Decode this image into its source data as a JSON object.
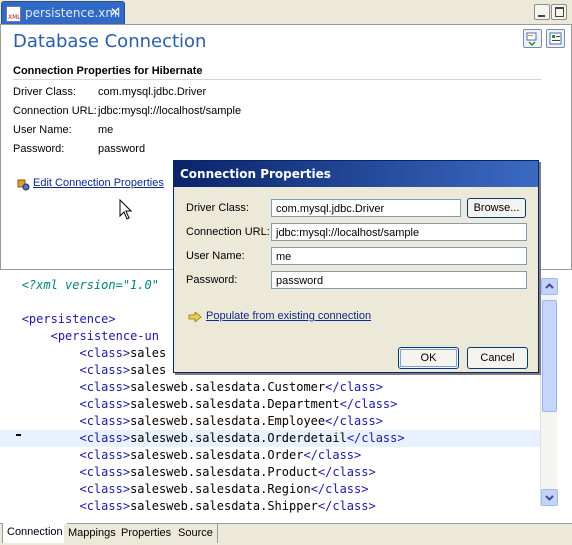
{
  "editor_tab": {
    "title": "persistence.xml",
    "icon": "xml-file-icon",
    "close_glyph": "✕"
  },
  "form": {
    "title": "Database Connection",
    "section_title": "Connection Properties for Hibernate",
    "properties": [
      {
        "label": "Driver Class:",
        "value": "com.mysql.jdbc.Driver"
      },
      {
        "label": "Connection URL:",
        "value": "jdbc:mysql://localhost/sample"
      },
      {
        "label": "User Name:",
        "value": "me"
      },
      {
        "label": "Password:",
        "value": "password"
      }
    ],
    "edit_link": "Edit Connection Properties"
  },
  "xml_lines": [
    {
      "pi": "<?xml version=\"1.0\""
    },
    {
      "text": ""
    },
    {
      "tag": "<persistence>"
    },
    {
      "indent": "    ",
      "tag": "<persistence-un"
    },
    {
      "indent": "        ",
      "tag": "<class>",
      "text": "sales"
    },
    {
      "indent": "        ",
      "tag": "<class>",
      "text": "sales"
    },
    {
      "indent": "        ",
      "tag": "<class>",
      "text": "salesweb.salesdata.Customer",
      "close": "</class>"
    },
    {
      "indent": "        ",
      "tag": "<class>",
      "text": "salesweb.salesdata.Department",
      "close": "</class>"
    },
    {
      "indent": "        ",
      "tag": "<class>",
      "text": "salesweb.salesdata.Employee",
      "close": "</class>"
    },
    {
      "indent": "        ",
      "tag": "<class>",
      "text": "salesweb.salesdata.Orderdetail",
      "close": "</class>"
    },
    {
      "indent": "        ",
      "tag": "<class>",
      "text": "salesweb.salesdata.Order",
      "close": "</class>"
    },
    {
      "indent": "        ",
      "tag": "<class>",
      "text": "salesweb.salesdata.Product",
      "close": "</class>"
    },
    {
      "indent": "        ",
      "tag": "<class>",
      "text": "salesweb.salesdata.Region",
      "close": "</class>"
    },
    {
      "indent": "        ",
      "tag": "<class>",
      "text": "salesweb.salesdata.Shipper",
      "close": "</class>"
    }
  ],
  "bottom_tabs": [
    "Connection",
    "Mappings",
    "Properties",
    "Source"
  ],
  "active_bottom_tab": "Connection",
  "dialog": {
    "title": "Connection Properties",
    "fields": [
      {
        "label": "Driver Class:",
        "value": "com.mysql.jdbc.Driver"
      },
      {
        "label": "Connection URL:",
        "value": "jdbc:mysql://localhost/sample"
      },
      {
        "label": "User Name:",
        "value": "me"
      },
      {
        "label": "Password:",
        "value": "password"
      }
    ],
    "browse_label": "Browse...",
    "populate_link": "Populate from existing connection",
    "ok_label": "OK",
    "cancel_label": "Cancel"
  },
  "colors": {
    "title_blue": "#2a5ea8",
    "tab_active": "#3169c6",
    "dialog_title": "#0a246a",
    "link": "#0b2a8c"
  }
}
